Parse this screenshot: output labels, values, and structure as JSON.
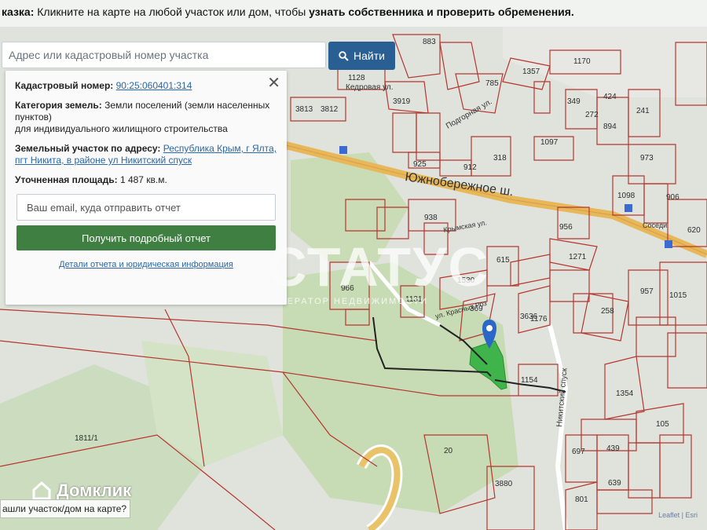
{
  "hint": {
    "prefix": "казка:",
    "text": " Кликните на карте на любой участок или дом, чтобы ",
    "bold": "узнать собственника и проверить обременения."
  },
  "search": {
    "placeholder": "Адрес или кадастровый номер участка",
    "button_label": "Найти",
    "button_icon": "search-icon"
  },
  "panel": {
    "cadastral_label": "Кадастровый номер:",
    "cadastral_value": "90:25:060401:314",
    "category_label": "Категория земель:",
    "category_value": "Земли поселений (земли населенных пунктов)",
    "category_use": "для индивидуального жилищного строительства",
    "address_label": "Земельный участок по адресу:",
    "address_value": "Республика Крым, г Ялта, пгт Никита, в районе ул Никитский спуск",
    "area_label": "Уточненная площадь:",
    "area_value": "1 487 кв.м.",
    "email_placeholder": "Ваш email, куда отправить отчет",
    "report_button": "Получить подробный отчет",
    "details_link": "Детали отчета и юридическая информация"
  },
  "map": {
    "streets": [
      "Южнобережное ш.",
      "Кедровая ул.",
      "Подгорная ул.",
      "Никитский спуск",
      "ул. Красных Роз",
      "Крымская ул.",
      "Соседи"
    ],
    "parcels": [
      "883",
      "1170",
      "1357",
      "1128",
      "3919",
      "785",
      "3813",
      "3812",
      "938",
      "925",
      "912",
      "1097",
      "973",
      "1098",
      "956",
      "1271",
      "966",
      "1530",
      "615",
      "1131",
      "1176",
      "369",
      "1154",
      "1354",
      "1015",
      "957",
      "258",
      "697",
      "105",
      "439",
      "639",
      "20",
      "1811/1",
      "801",
      "3880",
      "3636",
      "318",
      "349",
      "272",
      "424",
      "894",
      "241",
      "620",
      "906"
    ],
    "watermark": "СТАТУС",
    "watermark_sub": "ОПЕРАТОР НЕДВИЖИМОСТИ",
    "logo": "Домклик",
    "bottom_text": "ашли участок/дом на карте?",
    "attribution": "Leaflet | Esri"
  },
  "colors": {
    "button_blue": "#2a5f93",
    "report_green": "#3f7f41",
    "parcel_line": "#b5372f",
    "selected_parcel": "#3fb44b"
  }
}
